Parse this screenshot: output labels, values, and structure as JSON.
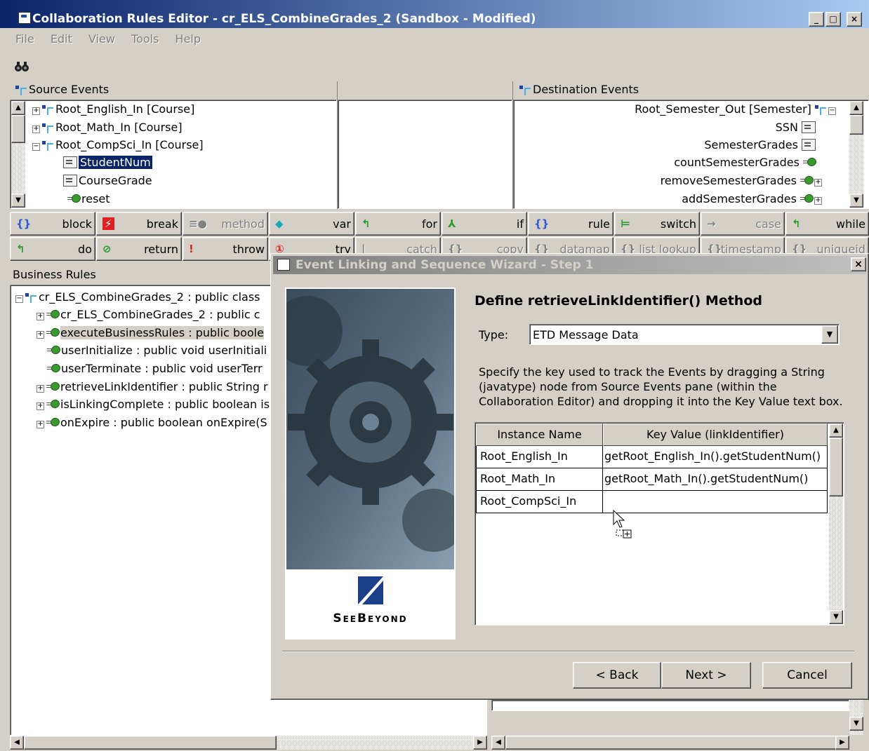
{
  "window": {
    "title": "Collaboration Rules Editor - cr_ELS_CombineGrades_2 (Sandbox - Modified)",
    "controls": [
      "_",
      "□",
      "×"
    ]
  },
  "menu": [
    "File",
    "Edit",
    "View",
    "Tools",
    "Help"
  ],
  "source_events": {
    "label": "Source Events",
    "items": [
      "Root_English_In [Course]",
      "Root_Math_In [Course]",
      "Root_CompSci_In [Course]",
      "StudentNum",
      "CourseGrade",
      "reset"
    ]
  },
  "destination_events": {
    "label": "Destination Events",
    "items": [
      "Root_Semester_Out [Semester]",
      "SSN",
      "SemesterGrades",
      "countSemesterGrades",
      "removeSemesterGrades",
      "addSemesterGrades"
    ]
  },
  "toolbar_row1": [
    "block",
    "break",
    "method",
    "var",
    "for",
    "if",
    "rule",
    "switch",
    "case",
    "while"
  ],
  "toolbar_row2": [
    "do",
    "return",
    "throw",
    "try",
    "catch",
    "copy",
    "datamap",
    "list lookup",
    "timestamp",
    "uniqueid"
  ],
  "business_rules": {
    "label": "Business Rules",
    "items": [
      "cr_ELS_CombineGrades_2 : public class",
      "cr_ELS_CombineGrades_2 : public c",
      "executeBusinessRules : public boole",
      "userInitialize : public void userInitiali",
      "userTerminate : public void userTerr",
      "retrieveLinkIdentifier : public String r",
      "isLinkingComplete : public boolean is",
      "onExpire : public boolean onExpire(S"
    ]
  },
  "dialog": {
    "title": "Event Linking and Sequence Wizard - Step 1",
    "heading": "Define retrieveLinkIdentifier() Method",
    "type_label": "Type:",
    "type_value": "ETD Message Data",
    "instructions": "Specify the key used to track the Events by dragging a String (javatype) node from Source Events pane (within the Collaboration Editor) and dropping it into the Key Value text box.",
    "brand": "SeeBeyond",
    "table": {
      "headers": [
        "Instance Name",
        "Key Value (linkIdentifier)"
      ],
      "rows": [
        [
          "Root_English_In",
          "getRoot_English_In().getStudentNum()"
        ],
        [
          "Root_Math_In",
          "getRoot_Math_In().getStudentNum()"
        ],
        [
          "Root_CompSci_In",
          ""
        ]
      ]
    },
    "buttons": {
      "back": "< Back",
      "next": "Next >",
      "cancel": "Cancel"
    }
  },
  "colors": {
    "title_active": "#0a246a",
    "title_inactive": "#808080",
    "face": "#d4d0c8",
    "selection": "#0a246a"
  }
}
